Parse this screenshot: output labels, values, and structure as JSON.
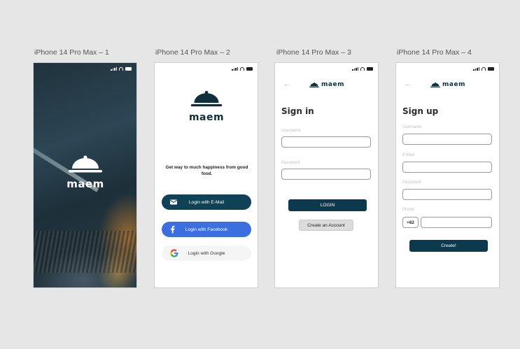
{
  "frames": [
    {
      "label": "iPhone 14 Pro Max – 1"
    },
    {
      "label": "iPhone 14 Pro Max – 2"
    },
    {
      "label": "iPhone 14 Pro Max – 3"
    },
    {
      "label": "iPhone 14 Pro Max – 4"
    }
  ],
  "brand": {
    "name": "maem",
    "color": "#0f2f3d"
  },
  "splash": {
    "brand": "maem"
  },
  "welcome": {
    "tagline": "Get way to much happiness from good food.",
    "email_button": "Login with E-Mail",
    "facebook_button": "Login with Facebook",
    "google_button": "Login with Google"
  },
  "signin": {
    "back_icon": "arrow-left-icon",
    "title": "Sign in",
    "username_label": "Username",
    "password_label": "Password",
    "login_button": "LOGIN",
    "create_account_button": "Create an Account"
  },
  "signup": {
    "title": "Sign up",
    "username_label": "Username",
    "email_label": "E-Mail",
    "password_label": "Password",
    "phone_label": "Phone",
    "phone_code": "+62",
    "create_button": "Create!"
  },
  "colors": {
    "primary": "#0b3a4e",
    "facebook": "#3b6fe0",
    "background": "#e6e6e6"
  }
}
